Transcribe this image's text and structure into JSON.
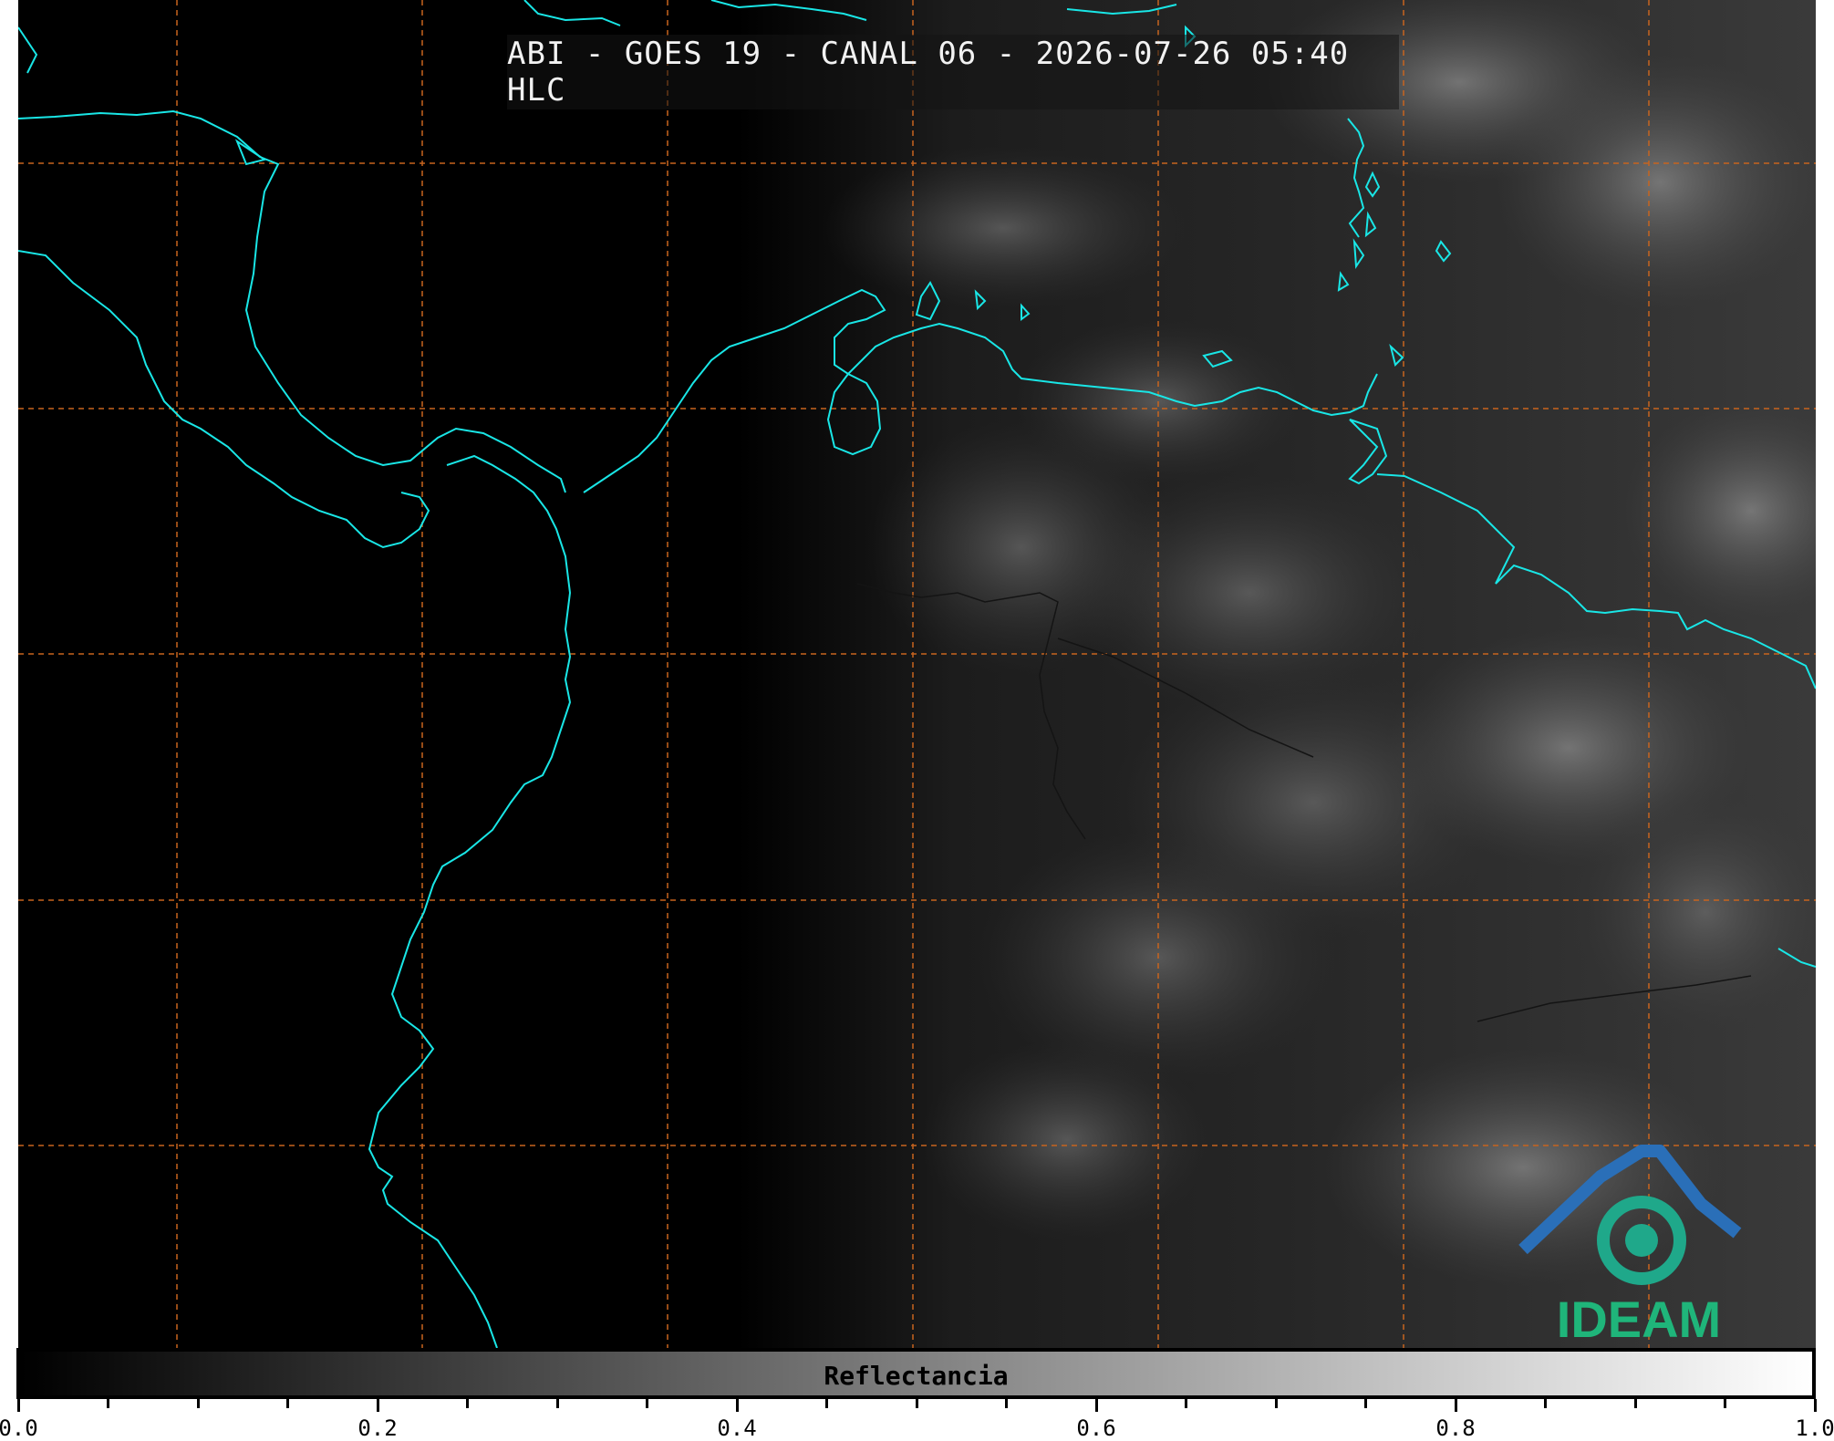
{
  "title": "ABI - GOES 19 - CANAL 06 - 2026-07-26 05:40 HLC",
  "colorbar": {
    "label": "Reflectancia",
    "ticks": [
      "0.0",
      "0.2",
      "0.4",
      "0.6",
      "0.8",
      "1.0"
    ],
    "min": 0.0,
    "max": 1.0
  },
  "logo": {
    "text": "IDEAM"
  },
  "colors": {
    "coastline": "#19e6e6",
    "gridlines": "#c8641e",
    "logo_blue": "#2a6fb8",
    "logo_green": "#1fb57a"
  }
}
